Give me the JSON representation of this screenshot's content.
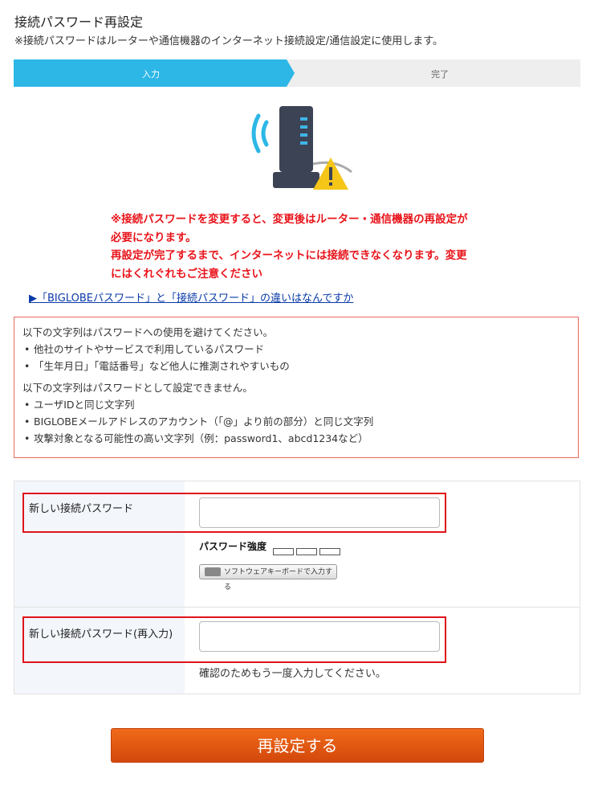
{
  "header": {
    "title": "接続パスワード再設定",
    "subtitle": "※接続パスワードはルーターや通信機器のインターネット接続設定/通信設定に使用します。"
  },
  "steps": [
    {
      "label": "入力",
      "active": true
    },
    {
      "label": "完了",
      "active": false
    }
  ],
  "colors": {
    "accent": "#2db7e6",
    "warning": "#e8141b",
    "button": "#e15a12"
  },
  "illustration": {
    "icon": "router-warning-icon"
  },
  "warning": {
    "lines": [
      "※接続パスワードを変更すると、変更後はルーター・通信機器の再設定が",
      "必要になります。",
      "再設定が完了するまで、インターネットには接続できなくなります。変更",
      "にはくれぐれもご注意ください"
    ]
  },
  "link": {
    "text": "▶「BIGLOBEパスワード」と「接続パスワード」の違いはなんですか"
  },
  "rules": {
    "avoid_heading": "以下の文字列はパスワードへの使用を避けてください。",
    "avoid_items": [
      "他社のサイトやサービスで利用しているパスワード",
      "「生年月日」「電話番号」など他人に推測されやすいもの"
    ],
    "forbidden_heading": "以下の文字列はパスワードとして設定できません。",
    "forbidden_items": [
      "ユーザIDと同じ文字列",
      "BIGLOBEメールアドレスのアカウント（「@」より前の部分）と同じ文字列",
      "攻撃対象となる可能性の高い文字列（例：password1、abcd1234など）"
    ]
  },
  "form": {
    "new_password_label": "新しい接続パスワード",
    "new_password_value": "",
    "strength_label": "パスワード強度",
    "keyboard_button": "ソフトウェアキーボードで入力する",
    "confirm_label": "新しい接続パスワード(再入力)",
    "confirm_value": "",
    "confirm_note": "確認のためもう一度入力してください。"
  },
  "submit": {
    "label": "再設定する"
  }
}
